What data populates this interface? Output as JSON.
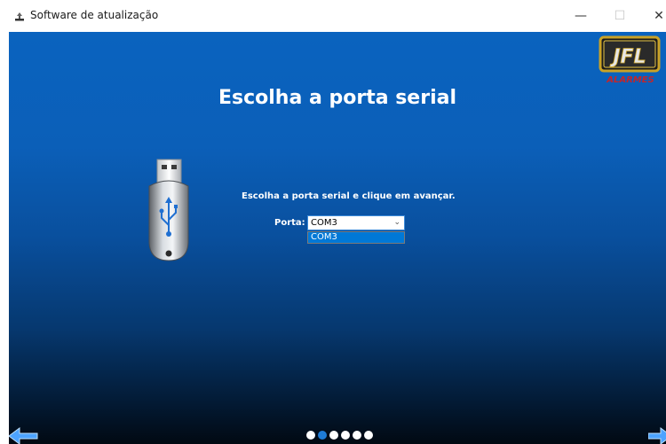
{
  "window": {
    "title": "Software de atualização",
    "controls": [
      "minimize",
      "maximize",
      "close"
    ]
  },
  "logo": {
    "main": "JFL",
    "sub": "ALARMES"
  },
  "heading": "Escolha a porta serial",
  "instruction": "Escolha a porta serial e clique em avançar.",
  "port": {
    "label": "Porta:",
    "selected": "COM3",
    "options": [
      "COM3"
    ]
  },
  "pagination": {
    "total": 6,
    "current": 2
  },
  "icons": {
    "minimize": "—",
    "maximize": "☐",
    "close": "✕",
    "chevron": "⌄"
  }
}
